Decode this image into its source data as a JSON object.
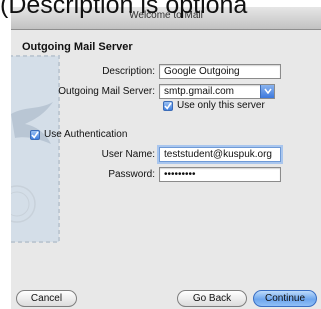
{
  "overlay_caption": "(Description is optiona",
  "window": {
    "title": "Welcome to Mail"
  },
  "section_title": "Outgoing Mail Server",
  "fields": {
    "description": {
      "label": "Description:",
      "value": "Google Outgoing"
    },
    "outgoing_server": {
      "label": "Outgoing Mail Server:",
      "value": "smtp.gmail.com"
    },
    "use_only_server": {
      "label": "Use only this server",
      "checked": true
    },
    "use_authentication": {
      "label": "Use Authentication",
      "checked": true
    },
    "user_name": {
      "label": "User Name:",
      "value": "teststudent@kuspuk.org"
    },
    "password": {
      "label": "Password:",
      "value": "•••••••••"
    }
  },
  "buttons": {
    "cancel": "Cancel",
    "go_back": "Go Back",
    "continue": "Continue"
  },
  "colors": {
    "accent": "#3f7fe0",
    "focus_ring": "#a9c6ee"
  },
  "icons": [
    "mail-stamp-eagle-icon",
    "chevron-down-icon",
    "checkmark-icon"
  ]
}
